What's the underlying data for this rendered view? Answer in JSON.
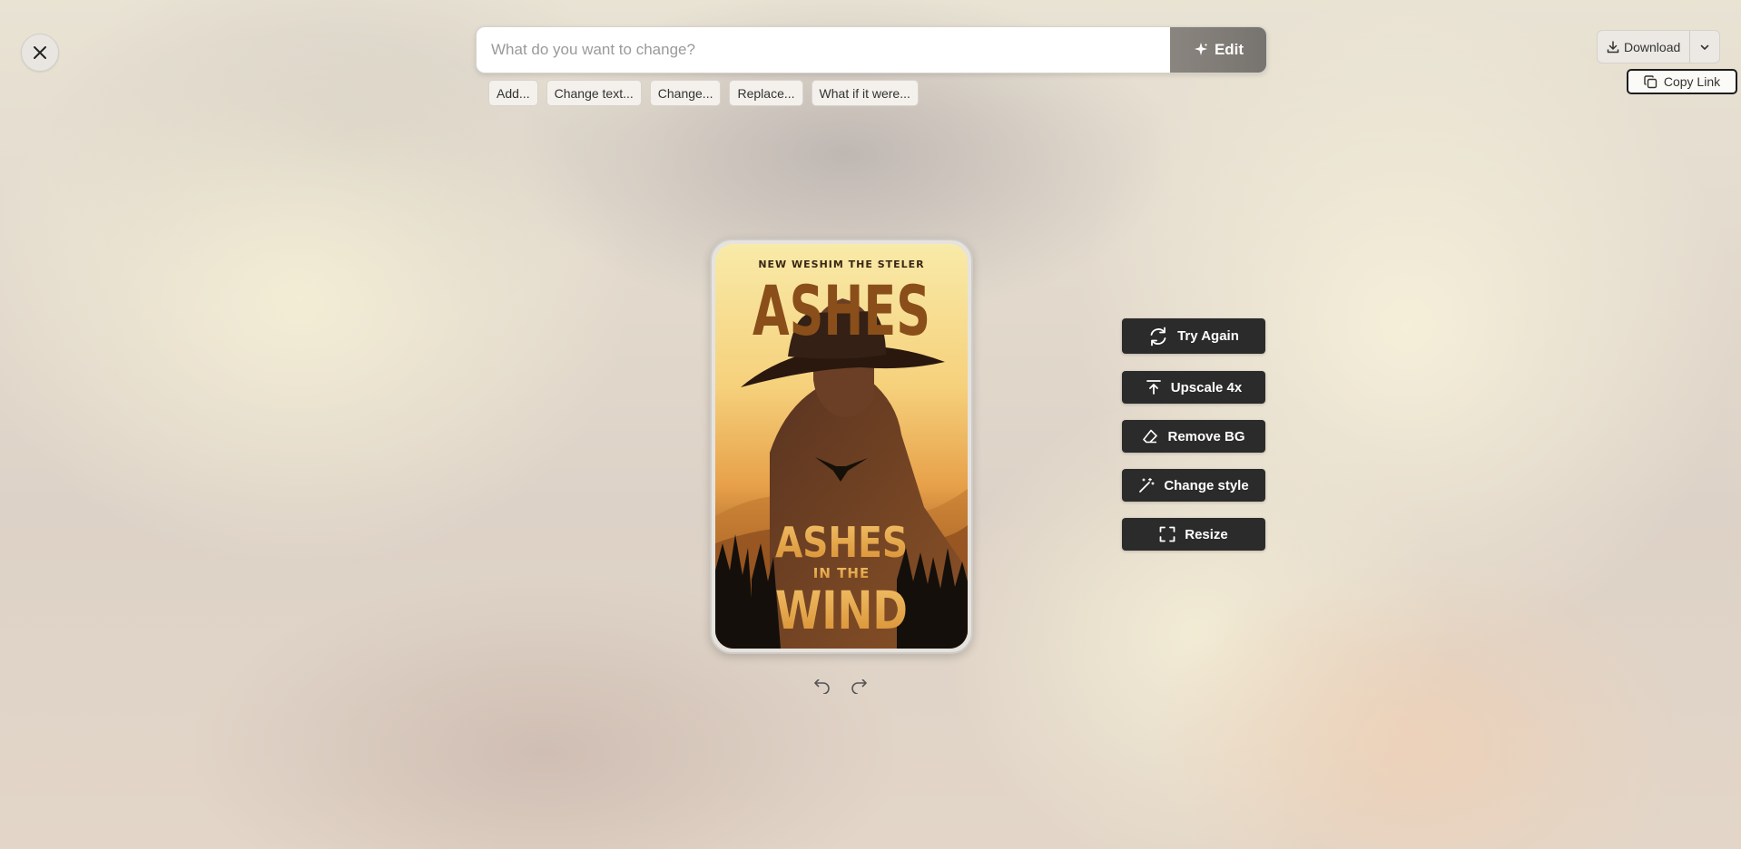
{
  "prompt": {
    "placeholder": "What do you want to change?",
    "edit_label": "Edit"
  },
  "suggestions": [
    "Add...",
    "Change text...",
    "Change...",
    "Replace...",
    "What if it were..."
  ],
  "download": {
    "label": "Download",
    "copy_link_label": "Copy Link"
  },
  "cover": {
    "top_line": "NEW WESHIM THE STELER",
    "top_title": "ASHES",
    "bottom_title_1": "ASHES",
    "bottom_title_2": "IN THE",
    "bottom_title_3": "WIND"
  },
  "actions": {
    "try_again": "Try Again",
    "upscale": "Upscale 4x",
    "remove_bg": "Remove BG",
    "change_style": "Change style",
    "resize": "Resize"
  },
  "icons": {
    "close": "close-icon",
    "edit": "sparkle-icon",
    "download": "download-icon",
    "caret": "chevron-down-icon",
    "copy": "copy-icon",
    "undo": "undo-icon",
    "redo": "redo-icon",
    "try_again": "refresh-icon",
    "upscale": "upscale-icon",
    "remove_bg": "eraser-icon",
    "change_style": "magic-wand-icon",
    "resize": "resize-icon"
  }
}
